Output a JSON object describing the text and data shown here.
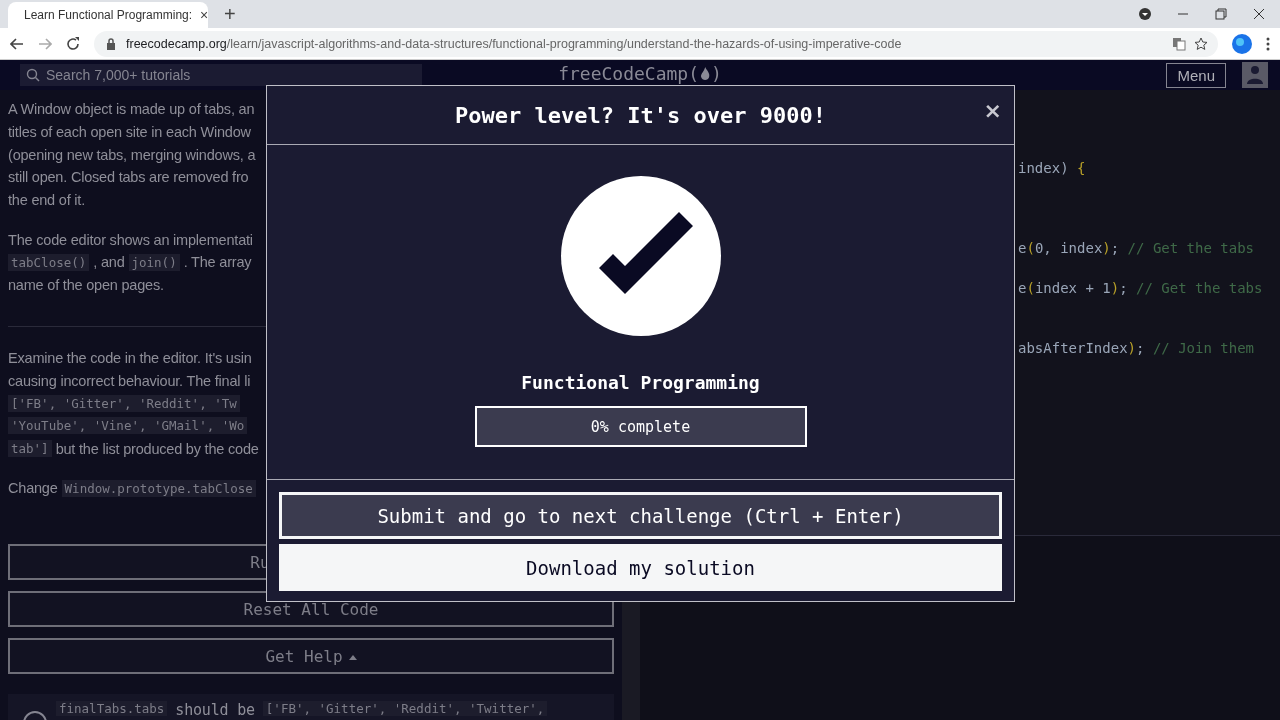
{
  "browser": {
    "tab": {
      "title": "Learn Functional Programming:",
      "close": "×"
    },
    "new_tab": "+",
    "url": {
      "host": "freecodecamp.org",
      "path": "/learn/javascript-algorithms-and-data-structures/functional-programming/understand-the-hazards-of-using-imperative-code"
    }
  },
  "navbar": {
    "search": {
      "placeholder": "Search 7,000+ tutorials"
    },
    "logo": {
      "name": "freeCodeCamp",
      "open": "(",
      "close": ")"
    },
    "menu": "Menu"
  },
  "instructions": {
    "blocks": [
      {
        "kind": "para",
        "lines": [
          [
            {
              "kind": "text",
              "text": "A Window object is made up of tabs, an"
            }
          ],
          [
            {
              "kind": "text",
              "text": "titles of each open site in each Window"
            }
          ],
          [
            {
              "kind": "text",
              "text": "(opening new tabs, merging windows, a"
            }
          ],
          [
            {
              "kind": "text",
              "text": "still open. Closed tabs are removed fro"
            }
          ],
          [
            {
              "kind": "text",
              "text": "the end of it."
            }
          ]
        ]
      },
      {
        "kind": "para",
        "lines": [
          [
            {
              "kind": "text",
              "text": "The code editor shows an implementati"
            }
          ],
          [
            {
              "kind": "code",
              "text": "tabClose()"
            },
            {
              "kind": "text",
              "text": ", and"
            },
            {
              "kind": "code",
              "text": "join()"
            },
            {
              "kind": "text",
              "text": ". The array"
            }
          ],
          [
            {
              "kind": "text",
              "text": "name of the open pages."
            }
          ]
        ]
      },
      {
        "kind": "rule"
      },
      {
        "kind": "para",
        "lines": [
          [
            {
              "kind": "text",
              "text": "Examine the code in the editor. It's usin"
            }
          ],
          [
            {
              "kind": "text",
              "text": "causing incorrect behaviour. The final li"
            }
          ],
          [
            {
              "kind": "code",
              "text": "['FB', 'Gitter', 'Reddit', 'Tw"
            }
          ],
          [
            {
              "kind": "code",
              "text": "'YouTube', 'Vine', 'GMail', 'Wo"
            }
          ],
          [
            {
              "kind": "code",
              "text": "tab']"
            },
            {
              "kind": "text",
              "text": "but the list produced by the code"
            }
          ]
        ]
      },
      {
        "kind": "para",
        "lines": [
          [
            {
              "kind": "text",
              "text": "Change"
            },
            {
              "kind": "code",
              "text": "Window.prototype.tabClose"
            }
          ]
        ]
      }
    ],
    "buttons": [
      {
        "label": "Ru",
        "kind": "plain"
      },
      {
        "label": "Reset All Code",
        "kind": "plain"
      },
      {
        "label": "Get Help",
        "kind": "dropdown"
      }
    ],
    "test": [
      {
        "kind": "code",
        "text": "finalTabs.tabs"
      },
      {
        "kind": "text",
        "text": "should be"
      },
      {
        "kind": "code",
        "text": "['FB', 'Gitter', 'Reddit', 'Twitter',"
      }
    ]
  },
  "editor": {
    "lines": [
      [
        {
          "kind": "plain",
          "text": "index) "
        },
        {
          "kind": "bracket",
          "text": "{"
        }
      ],
      [
        {
          "kind": "plain",
          "text": "e"
        },
        {
          "kind": "bracket",
          "text": "("
        },
        {
          "kind": "plain",
          "text": "0, index"
        },
        {
          "kind": "bracket",
          "text": ")"
        },
        {
          "kind": "plain",
          "text": "; "
        },
        {
          "kind": "comment",
          "text": "// Get the tabs"
        }
      ],
      [
        {
          "kind": "plain",
          "text": "e"
        },
        {
          "kind": "bracket",
          "text": "("
        },
        {
          "kind": "plain",
          "text": "index + 1"
        },
        {
          "kind": "bracket",
          "text": ")"
        },
        {
          "kind": "plain",
          "text": "; "
        },
        {
          "kind": "comment",
          "text": "// Get the tabs"
        }
      ],
      [
        {
          "kind": "plain",
          "text": "absAfterIndex"
        },
        {
          "kind": "bracket",
          "text": ")"
        },
        {
          "kind": "plain",
          "text": "; "
        },
        {
          "kind": "comment",
          "text": "// Join them"
        }
      ]
    ]
  },
  "modal": {
    "title": "Power level? It's over 9000!",
    "close": "×",
    "block_title": "Functional Programming",
    "progress": {
      "level": 0,
      "label": "0% complete"
    },
    "buttons": [
      {
        "label": "Submit and go to next challenge (Ctrl + Enter)",
        "kind": "primary"
      },
      {
        "label": "Download my solution",
        "kind": "secondary"
      }
    ]
  }
}
